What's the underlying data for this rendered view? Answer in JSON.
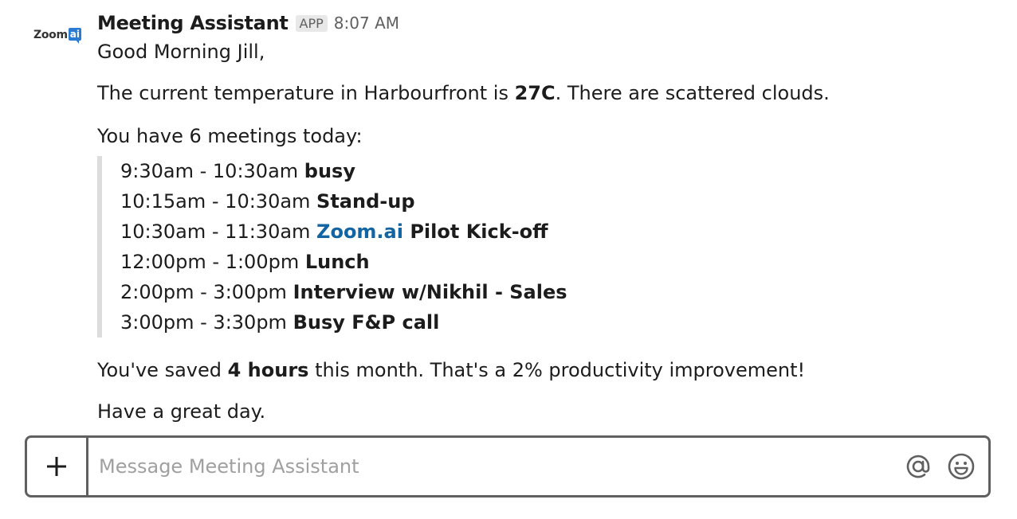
{
  "avatar": {
    "logo_main": "Zoom",
    "logo_suffix": "ai"
  },
  "message": {
    "sender": "Meeting Assistant",
    "badge": "APP",
    "time": "8:07 AM",
    "greeting": "Good Morning Jill,",
    "weather": {
      "prefix": "The current temperature in Harbourfront is ",
      "temp": "27C",
      "suffix": ". There are scattered clouds."
    },
    "meetings_intro": "You have 6 meetings today:",
    "meetings": [
      {
        "time": "9:30am - 10:30am ",
        "link": "",
        "title": "busy"
      },
      {
        "time": "10:15am - 10:30am ",
        "link": "",
        "title": "Stand-up"
      },
      {
        "time": "10:30am - 11:30am ",
        "link": "Zoom.ai",
        "title": " Pilot Kick-off"
      },
      {
        "time": "12:00pm - 1:00pm ",
        "link": "",
        "title": "Lunch"
      },
      {
        "time": "2:00pm - 3:00pm ",
        "link": "",
        "title": "Interview w/Nikhil - Sales"
      },
      {
        "time": "3:00pm - 3:30pm ",
        "link": "",
        "title": "Busy F&P call"
      }
    ],
    "saved": {
      "prefix": "You've saved ",
      "amount": "4 hours",
      "suffix": " this month. That's a 2% productivity improvement!"
    },
    "closing": "Have a great day."
  },
  "composer": {
    "placeholder": "Message Meeting Assistant",
    "plus_label": "+",
    "icons": [
      "at-icon",
      "emoji-icon"
    ]
  }
}
